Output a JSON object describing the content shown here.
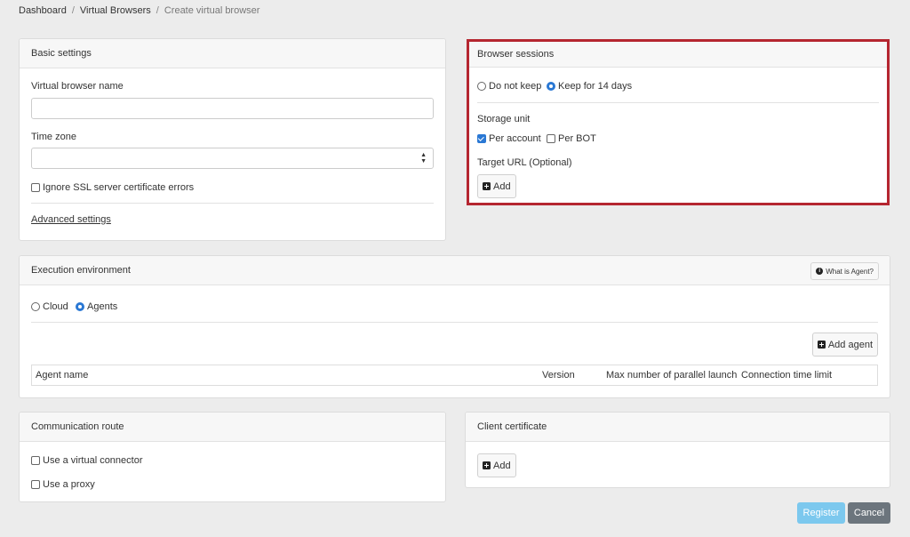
{
  "breadcrumb": {
    "items": [
      "Dashboard",
      "Virtual Browsers"
    ],
    "current": "Create virtual browser"
  },
  "basic_settings": {
    "title": "Basic settings",
    "name_label": "Virtual browser name",
    "name_value": "",
    "timezone_label": "Time zone",
    "timezone_value": "",
    "ignore_ssl_label": "Ignore SSL server certificate errors",
    "ignore_ssl_checked": false,
    "advanced_link": "Advanced settings"
  },
  "browser_sessions": {
    "title": "Browser sessions",
    "options": [
      "Do not keep",
      "Keep for 14 days"
    ],
    "selected": "Keep for 14 days",
    "storage_label": "Storage unit",
    "storage_options": [
      {
        "label": "Per account",
        "checked": true
      },
      {
        "label": "Per BOT",
        "checked": false
      }
    ],
    "target_label": "Target URL (Optional)",
    "add_label": "Add"
  },
  "execution": {
    "title": "Execution environment",
    "what_is_agent": "What is Agent?",
    "options": [
      "Cloud",
      "Agents"
    ],
    "selected": "Agents",
    "add_agent_label": "Add agent",
    "columns": [
      "Agent name",
      "Version",
      "Max number of parallel launch",
      "Connection time limit"
    ]
  },
  "communication": {
    "title": "Communication route",
    "virtual_connector_label": "Use a virtual connector",
    "proxy_label": "Use a proxy"
  },
  "client_certificate": {
    "title": "Client certificate",
    "add_label": "Add"
  },
  "actions": {
    "register_label": "Register",
    "cancel_label": "Cancel"
  },
  "colors": {
    "accent": "#2a78d4",
    "highlight": "#b52630",
    "register": "#7cc8ee",
    "cancel": "#6c757d"
  }
}
